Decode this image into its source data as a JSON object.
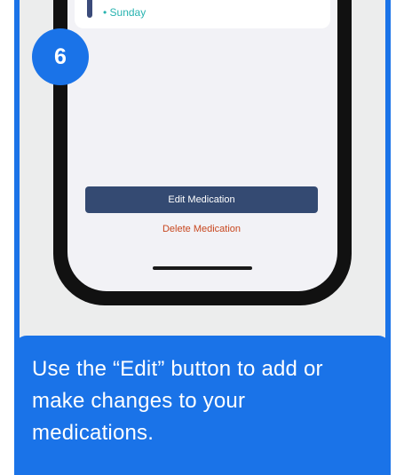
{
  "step": {
    "number": "6"
  },
  "screen": {
    "day_item": "• Sunday",
    "edit_button_label": "Edit Medication",
    "delete_label": "Delete Medication"
  },
  "caption": {
    "text": "Use the “Edit” button to add or make changes to your medications."
  },
  "colors": {
    "accent_blue": "#1a73e8",
    "button_navy": "#344a72",
    "delete_red": "#c8471f",
    "day_teal": "#28b3b0"
  }
}
